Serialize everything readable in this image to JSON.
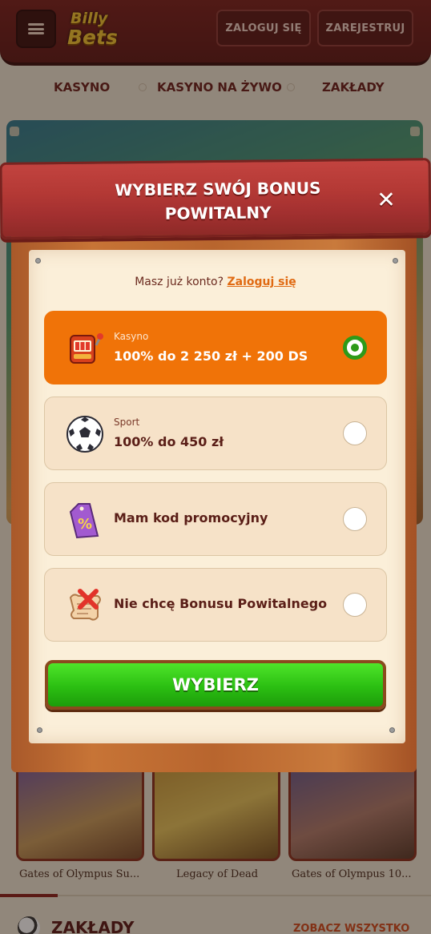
{
  "header": {
    "logo_line1": "Billy",
    "logo_line2": "Bets",
    "login_label": "ZALOGUJ SIĘ",
    "register_label": "ZAREJESTRUJ"
  },
  "nav": {
    "items": [
      "KASYNO",
      "KASYNO NA ŻYWO",
      "ZAKŁADY"
    ]
  },
  "games": {
    "names": [
      "Gates of Olympus Su...",
      "Legacy of Dead",
      "Gates of Olympus 10..."
    ],
    "section_title": "ZAKŁADY",
    "see_all": "ZOBACZ WSZYSTKO"
  },
  "modal": {
    "title_line1": "WYBIERZ SWÓJ BONUS",
    "title_line2": "POWITALNY",
    "close_symbol": "✕",
    "login_prompt": "Masz już konto?",
    "login_link": "Zaloguj się",
    "options": [
      {
        "small": "Kasyno",
        "main": "100% do 2 250 zł + 200 DS",
        "selected": true,
        "icon": "slot-machine-icon"
      },
      {
        "small": "Sport",
        "main": "100% do 450 zł",
        "selected": false,
        "icon": "soccer-ball-icon"
      },
      {
        "main": "Mam kod promocyjny",
        "selected": false,
        "icon": "percent-tag-icon"
      },
      {
        "main": "Nie chcę Bonusu Powitalnego",
        "selected": false,
        "icon": "no-bonus-scroll-icon"
      }
    ],
    "submit_label": "WYBIERZ"
  },
  "colors": {
    "accent_orange": "#f07308",
    "submit_green": "#2bbf12",
    "banner_red": "#b43935",
    "radio_selected": "#2e9a19"
  }
}
